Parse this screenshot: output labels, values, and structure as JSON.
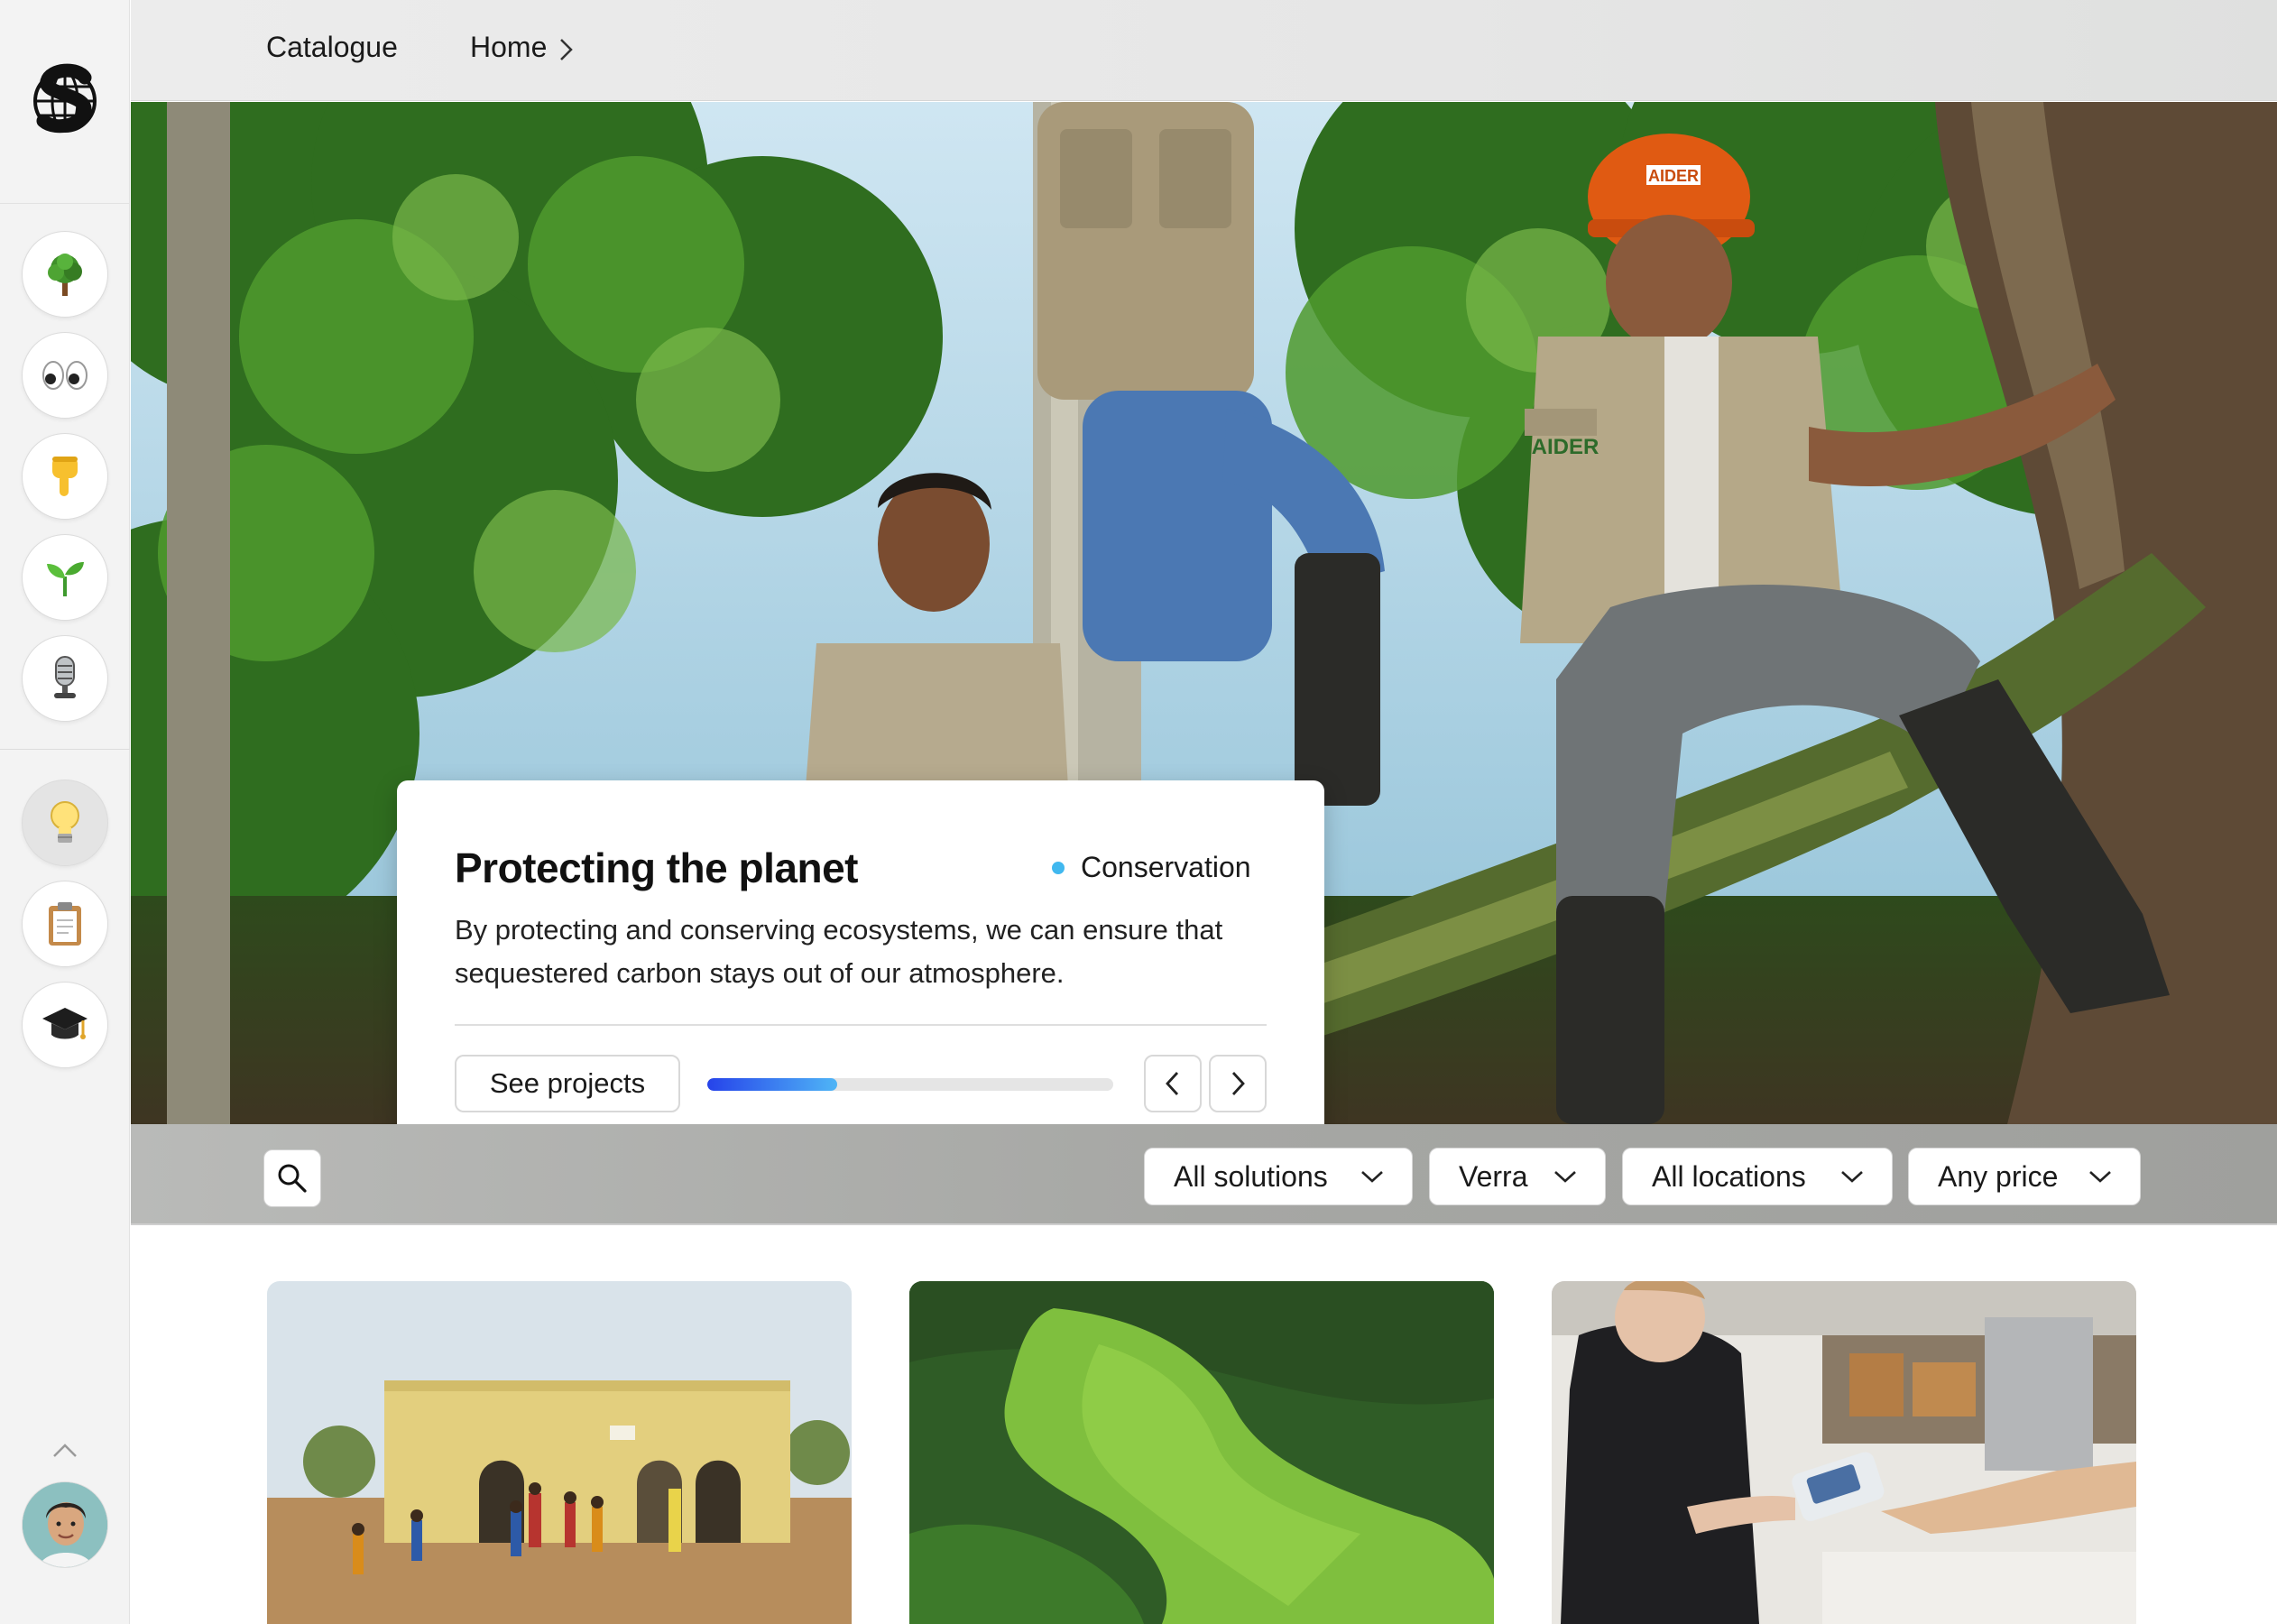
{
  "breadcrumb": {
    "items": [
      "Catalogue",
      "Home"
    ]
  },
  "sidebar": {
    "logo_icon": "globe-s-logo",
    "nav_icons": [
      "tree-icon",
      "eyes-icon",
      "pointing-down-icon",
      "seedling-icon",
      "microphone-icon"
    ],
    "secondary_icons": [
      "lightbulb-icon",
      "clipboard-icon",
      "graduation-cap-icon"
    ],
    "active_icon": "lightbulb-icon"
  },
  "hero": {
    "title": "Protecting the planet",
    "category": "Conservation",
    "category_color": "#41b8ef",
    "description": "By protecting and conserving ecosystems, we can ensure that sequestered carbon stays out of our atmosphere.",
    "cta_label": "See projects",
    "progress": 0.32,
    "progress_colors": [
      "#2643ea",
      "#4fb5f6"
    ],
    "helmet_text": "AIDER",
    "vest_text": "AIDER"
  },
  "filters": {
    "search_icon": "search-icon",
    "dropdowns": [
      "All solutions",
      "Verra",
      "All locations",
      "Any price"
    ]
  },
  "projects": [
    {
      "image": "village-building-photo"
    },
    {
      "image": "aerial-forest-photo"
    },
    {
      "image": "card-payment-cafe-photo"
    }
  ]
}
